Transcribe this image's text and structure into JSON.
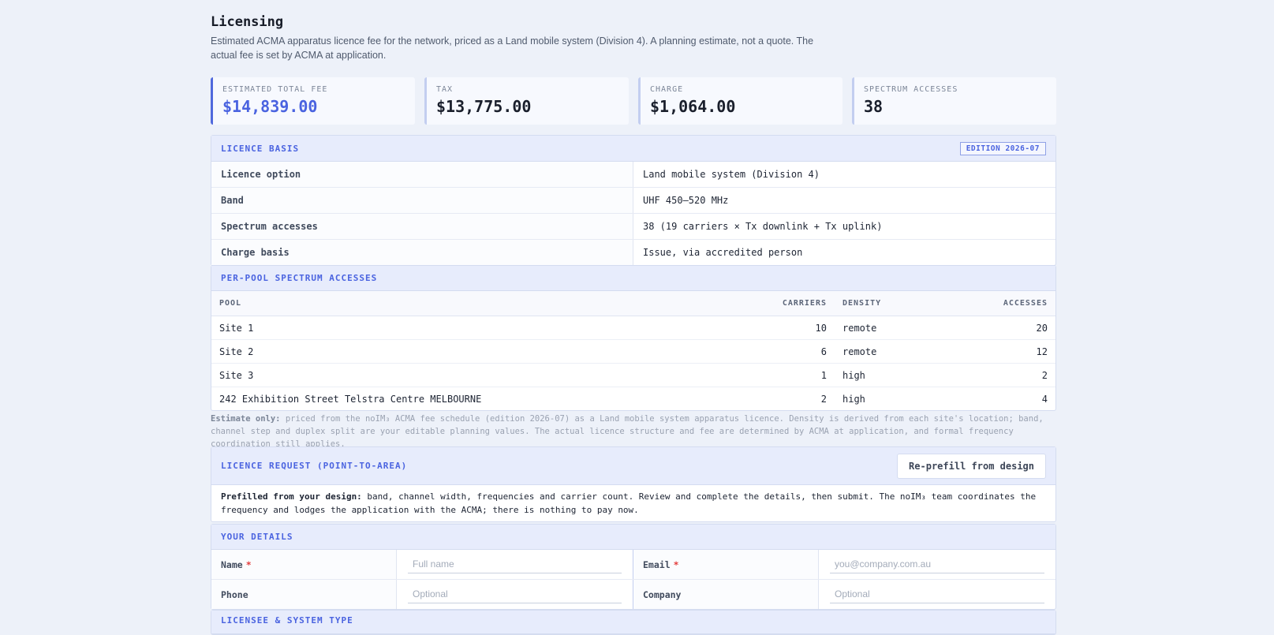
{
  "page": {
    "title": "Licensing",
    "subtitle": "Estimated ACMA apparatus licence fee for the network, priced as a Land mobile system (Division 4). A planning estimate, not a quote. The actual fee is set by ACMA at application."
  },
  "stats": [
    {
      "label": "ESTIMATED TOTAL FEE",
      "value": "$14,839.00"
    },
    {
      "label": "TAX",
      "value": "$13,775.00"
    },
    {
      "label": "CHARGE",
      "value": "$1,064.00"
    },
    {
      "label": "SPECTRUM ACCESSES",
      "value": "38"
    }
  ],
  "basis": {
    "heading": "LICENCE BASIS",
    "badge": "EDITION 2026-07",
    "rows": [
      {
        "key": "Licence option",
        "value": "Land mobile system (Division 4)"
      },
      {
        "key": "Band",
        "value": "UHF 450–520 MHz"
      },
      {
        "key": "Spectrum accesses",
        "value": "38 (19 carriers × Tx downlink + Tx uplink)"
      },
      {
        "key": "Charge basis",
        "value": "Issue, via accredited person"
      }
    ]
  },
  "pools": {
    "heading": "PER-POOL SPECTRUM ACCESSES",
    "columns": [
      "POOL",
      "CARRIERS",
      "DENSITY",
      "ACCESSES"
    ],
    "rows": [
      {
        "pool": "Site 1",
        "carriers": "10",
        "density": "remote",
        "accesses": "20"
      },
      {
        "pool": "Site 2",
        "carriers": "6",
        "density": "remote",
        "accesses": "12"
      },
      {
        "pool": "Site 3",
        "carriers": "1",
        "density": "high",
        "accesses": "2"
      },
      {
        "pool": "242 Exhibition Street Telstra Centre MELBOURNE",
        "carriers": "2",
        "density": "high",
        "accesses": "4"
      }
    ]
  },
  "note": {
    "lead": "Estimate only:",
    "text": " priced from the noIM₃ ACMA fee schedule (edition 2026-07) as a Land mobile system apparatus licence. Density is derived from each site's location; band, channel step and duplex split are your editable planning values. The actual licence structure and fee are determined by ACMA at application, and formal frequency coordination still applies."
  },
  "request": {
    "heading": "LICENCE REQUEST (POINT-TO-AREA)",
    "button": "Re-prefill from design",
    "lead": "Prefilled from your design:",
    "text": " band, channel width, frequencies and carrier count. Review and complete the details, then submit. The noIM₃ team coordinates the frequency and lodges the application with the ACMA; there is nothing to pay now."
  },
  "details": {
    "heading": "YOUR DETAILS",
    "name_label": "Name",
    "name_placeholder": "Full name",
    "email_label": "Email",
    "email_placeholder": "you@company.com.au",
    "phone_label": "Phone",
    "phone_placeholder": "Optional",
    "company_label": "Company",
    "company_placeholder": "Optional",
    "required_mark": "*"
  },
  "next_section": {
    "heading": "LICENSEE & SYSTEM TYPE"
  }
}
